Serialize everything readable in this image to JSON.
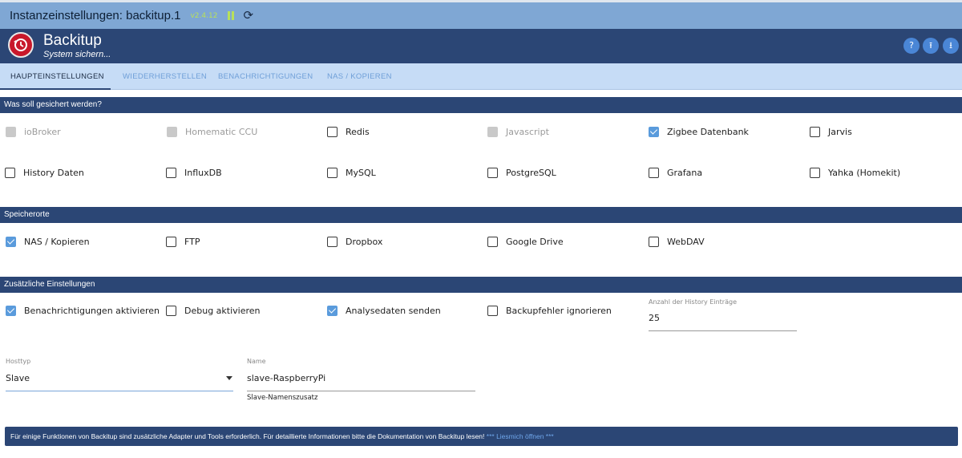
{
  "titlebar": {
    "title": "Instanzeinstellungen: backitup.1",
    "version": "v2.4.12"
  },
  "header": {
    "app_name": "Backitup",
    "app_subtitle": "System sichern...",
    "buttons": [
      "help-icon",
      "upload-icon",
      "download-icon"
    ]
  },
  "tabs": [
    {
      "label": "HAUPTEINSTELLUNGEN",
      "active": true
    },
    {
      "label": "WIEDERHERSTELLEN",
      "active": false
    },
    {
      "label": "BENACHRICHTIGUNGEN",
      "active": false
    },
    {
      "label": "NAS / KOPIEREN",
      "active": false
    }
  ],
  "sections": {
    "backup": "Was soll gesichert werden?",
    "storage": "Speicherorte",
    "extra": "Zusätzliche Einstellungen"
  },
  "backup_items": [
    {
      "label": "ioBroker",
      "checked": false,
      "disabled": true
    },
    {
      "label": "Homematic CCU",
      "checked": false,
      "disabled": true
    },
    {
      "label": "Redis",
      "checked": false,
      "disabled": false
    },
    {
      "label": "Javascript",
      "checked": false,
      "disabled": true
    },
    {
      "label": "Zigbee Datenbank",
      "checked": true,
      "disabled": false
    },
    {
      "label": "Jarvis",
      "checked": false,
      "disabled": false
    },
    {
      "label": "History Daten",
      "checked": false,
      "disabled": false
    },
    {
      "label": "InfluxDB",
      "checked": false,
      "disabled": false
    },
    {
      "label": "MySQL",
      "checked": false,
      "disabled": false
    },
    {
      "label": "PostgreSQL",
      "checked": false,
      "disabled": false
    },
    {
      "label": "Grafana",
      "checked": false,
      "disabled": false
    },
    {
      "label": "Yahka (Homekit)",
      "checked": false,
      "disabled": false
    }
  ],
  "storage_items": [
    {
      "label": "NAS / Kopieren",
      "checked": true
    },
    {
      "label": "FTP",
      "checked": false
    },
    {
      "label": "Dropbox",
      "checked": false
    },
    {
      "label": "Google Drive",
      "checked": false
    },
    {
      "label": "WebDAV",
      "checked": false
    }
  ],
  "extra_items": [
    {
      "label": "Benachrichtigungen aktivieren",
      "checked": true
    },
    {
      "label": "Debug aktivieren",
      "checked": false
    },
    {
      "label": "Analysedaten senden",
      "checked": true
    },
    {
      "label": "Backupfehler ignorieren",
      "checked": false
    }
  ],
  "history_count": {
    "label": "Anzahl der History Einträge",
    "value": "25"
  },
  "hosttyp": {
    "label": "Hosttyp",
    "value": "Slave"
  },
  "name": {
    "label": "Name",
    "value": "slave-RaspberryPi",
    "helper": "Slave-Namenszusatz"
  },
  "info": {
    "text": "Für einige Funktionen von Backitup sind zusätzliche Adapter und Tools erforderlich. Für detaillierte Informationen bitte die Dokumentation von Backitup lesen!",
    "link": "*** Liesmich öffnen ***"
  },
  "colors": {
    "primary": "#2b4675",
    "titlebar": "#7fa7d4",
    "tabs_bg": "#c6dcf6",
    "check": "#5a9bdc",
    "logo": "#c8182b"
  }
}
